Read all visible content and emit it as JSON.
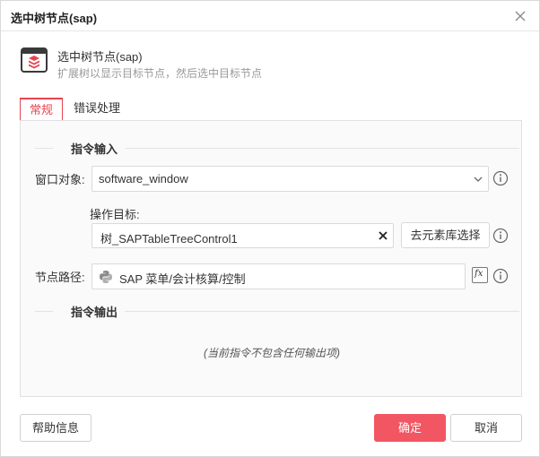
{
  "window": {
    "title": "选中树节点(sap)"
  },
  "header": {
    "icon": "sap-window-icon",
    "title": "选中树节点(sap)",
    "description": "扩展树以显示目标节点，然后选中目标节点"
  },
  "tabs": [
    {
      "label": "常规",
      "active": true
    },
    {
      "label": "错误处理",
      "active": false
    }
  ],
  "input_section": {
    "heading": "指令输入",
    "window_object": {
      "label": "窗口对象:",
      "value": "software_window"
    },
    "target": {
      "label": "操作目标:",
      "value": "树_SAPTableTreeControl1",
      "button_label": "去元素库选择"
    },
    "node_path": {
      "label": "节点路径:",
      "value": "SAP 菜单/会计核算/控制"
    }
  },
  "output_section": {
    "heading": "指令输出",
    "empty_text": "(当前指令不包含任何输出项)"
  },
  "footer": {
    "help_label": "帮助信息",
    "ok_label": "确定",
    "cancel_label": "取消"
  },
  "colors": {
    "accent": "#e8434f",
    "primary_button": "#f15662"
  }
}
